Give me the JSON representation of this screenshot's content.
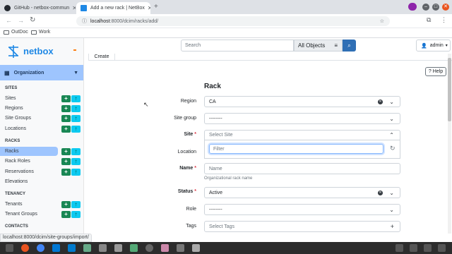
{
  "browser": {
    "tabs": [
      {
        "title": "GitHub - netbox-commun",
        "active": false
      },
      {
        "title": "Add a new rack | NetBox",
        "active": true
      }
    ],
    "new_tab": "+",
    "url_host": "localhost",
    "url_rest": ":8000/dcim/racks/add/",
    "bookmarks": [
      "OutDoc",
      "Work"
    ],
    "status_url": "localhost:8000/dcim/site-groups/import/"
  },
  "app": {
    "logo_text": "netbox",
    "search_placeholder": "Search",
    "search_scope": "All Objects",
    "user": "admin"
  },
  "sidebar": {
    "section_title": "Organization",
    "groups": [
      {
        "title": "SITES",
        "items": [
          "Sites",
          "Regions",
          "Site Groups",
          "Locations"
        ]
      },
      {
        "title": "RACKS",
        "items": [
          "Racks",
          "Rack Roles",
          "Reservations",
          "Elevations"
        ]
      },
      {
        "title": "TENANCY",
        "items": [
          "Tenants",
          "Tenant Groups"
        ]
      },
      {
        "title": "CONTACTS",
        "items": []
      }
    ],
    "selected": "Racks"
  },
  "page": {
    "tab_label": "Create",
    "help_label": "Help",
    "section_heading": "Rack",
    "fields": {
      "region": {
        "label": "Region",
        "value": "CA"
      },
      "site_group": {
        "label": "Site group",
        "value": "--------"
      },
      "site": {
        "label": "Site",
        "placeholder": "Select Site"
      },
      "location": {
        "label": "Location",
        "placeholder": "Filter"
      },
      "name": {
        "label": "Name",
        "placeholder": "Name",
        "help": "Organizational rack name"
      },
      "status": {
        "label": "Status",
        "value": "Active"
      },
      "role": {
        "label": "Role",
        "value": "--------"
      },
      "tags": {
        "label": "Tags",
        "placeholder": "Select Tags"
      }
    },
    "required_mark": "*"
  },
  "colors": {
    "accent": "#0d6efd",
    "sidebar_active": "#9ec5fe",
    "add_button": "#198754",
    "import_button": "#0dcaf0"
  }
}
